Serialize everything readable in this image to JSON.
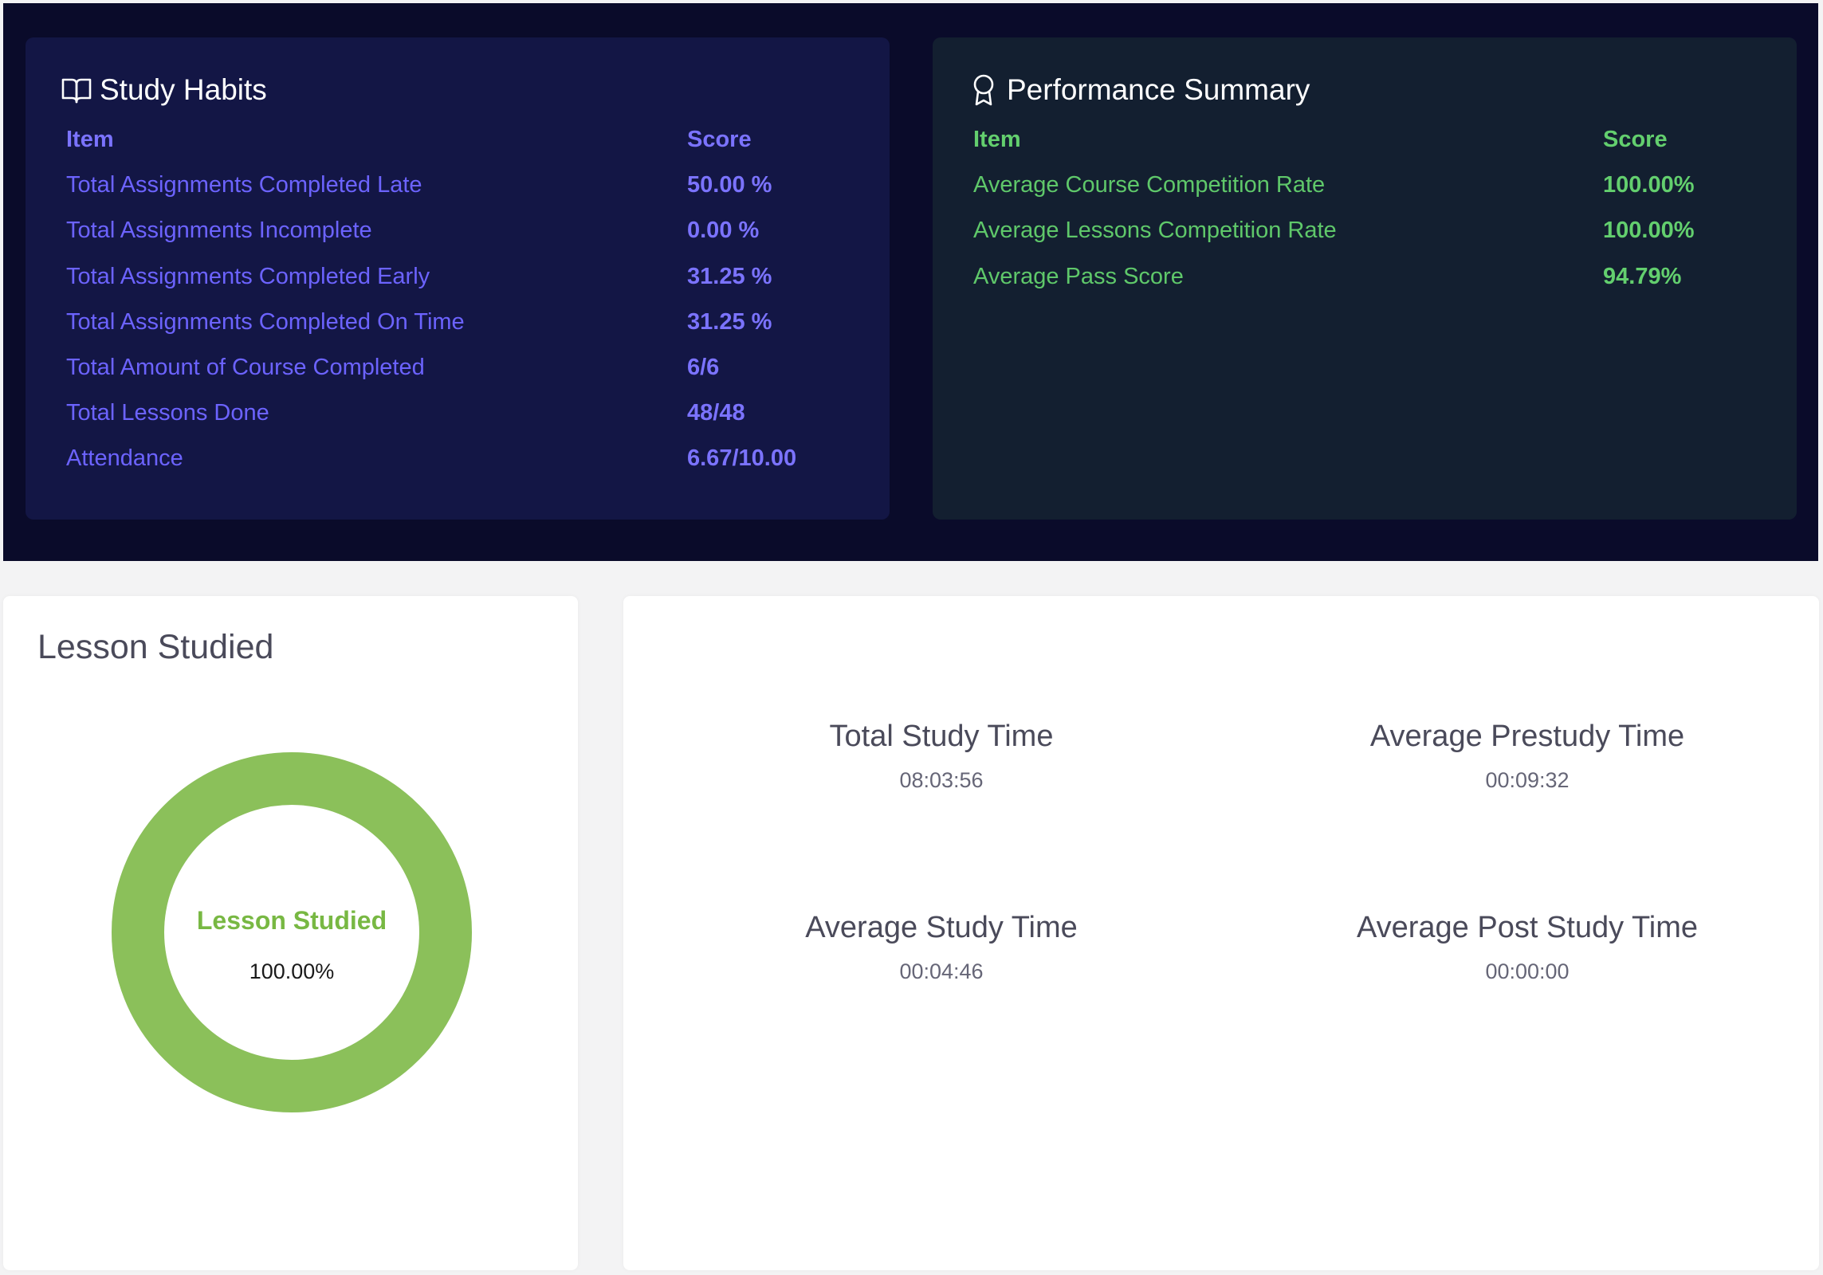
{
  "study_habits": {
    "title": "Study Habits",
    "icon": "book-open-icon",
    "header": {
      "item": "Item",
      "score": "Score"
    },
    "rows": [
      {
        "item": "Total Assignments Completed Late",
        "score": "50.00 %"
      },
      {
        "item": "Total Assignments Incomplete",
        "score": "0.00 %"
      },
      {
        "item": "Total Assignments Completed Early",
        "score": "31.25 %"
      },
      {
        "item": "Total Assignments Completed On Time",
        "score": "31.25 %"
      },
      {
        "item": "Total Amount of Course Completed",
        "score": "6/6"
      },
      {
        "item": "Total Lessons Done",
        "score": "48/48"
      },
      {
        "item": "Attendance",
        "score": "6.67/10.00"
      }
    ]
  },
  "performance_summary": {
    "title": "Performance Summary",
    "icon": "award-icon",
    "header": {
      "item": "Item",
      "score": "Score"
    },
    "rows": [
      {
        "item": "Average Course Competition Rate",
        "score": "100.00%"
      },
      {
        "item": "Average Lessons Competition Rate",
        "score": "100.00%"
      },
      {
        "item": "Average Pass Score",
        "score": "94.79%"
      }
    ]
  },
  "lesson_studied": {
    "title": "Lesson Studied",
    "center_label": "Lesson Studied",
    "center_value": "100.00%",
    "percent": 100,
    "color": "#8bc05a"
  },
  "study_times": {
    "total": {
      "label": "Total Study Time",
      "value": "08:03:56"
    },
    "prestudy": {
      "label": "Average Prestudy Time",
      "value": "00:09:32"
    },
    "average": {
      "label": "Average Study Time",
      "value": "00:04:46"
    },
    "post": {
      "label": "Average Post Study Time",
      "value": "00:00:00"
    }
  },
  "colors": {
    "band_bg": "#0a0b2a",
    "habits_bg": "#131645",
    "habits_text": "#6c63ff",
    "perf_bg": "#131f30",
    "perf_text": "#5fc86a"
  }
}
